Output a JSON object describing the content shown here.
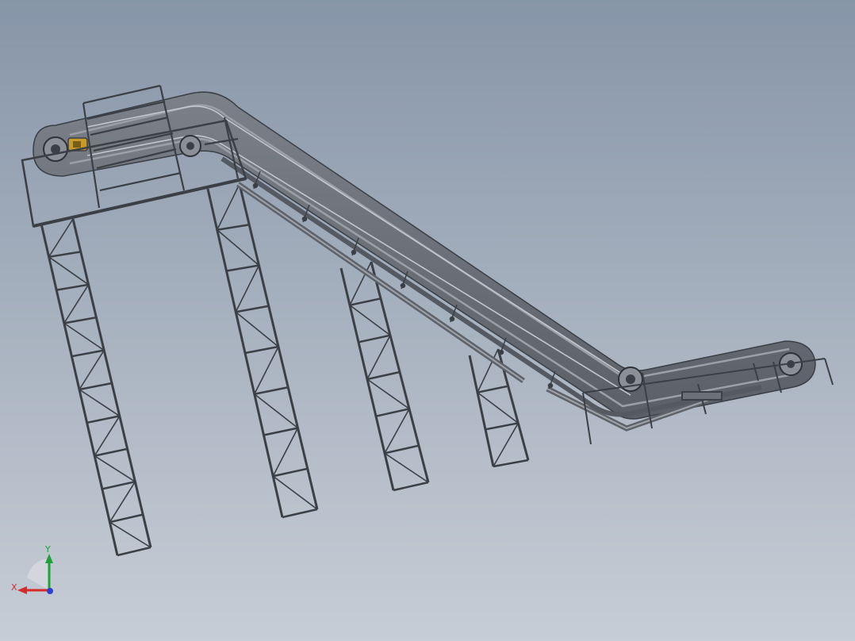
{
  "viewport": {
    "background_top": "#8795a8",
    "background_bottom": "#c7cdd6"
  },
  "model": {
    "description_icon": "inclined-conveyor-model",
    "belt_color": "#6c7078",
    "frame_color": "#3b3f46",
    "support_color": "#4a4e55",
    "motor_color": "#c79a2a"
  },
  "triad": {
    "x_label": "X",
    "y_label": "Y",
    "x_color": "#d42a2a",
    "y_color": "#1fa23a",
    "z_color": "#2a3fd4"
  }
}
